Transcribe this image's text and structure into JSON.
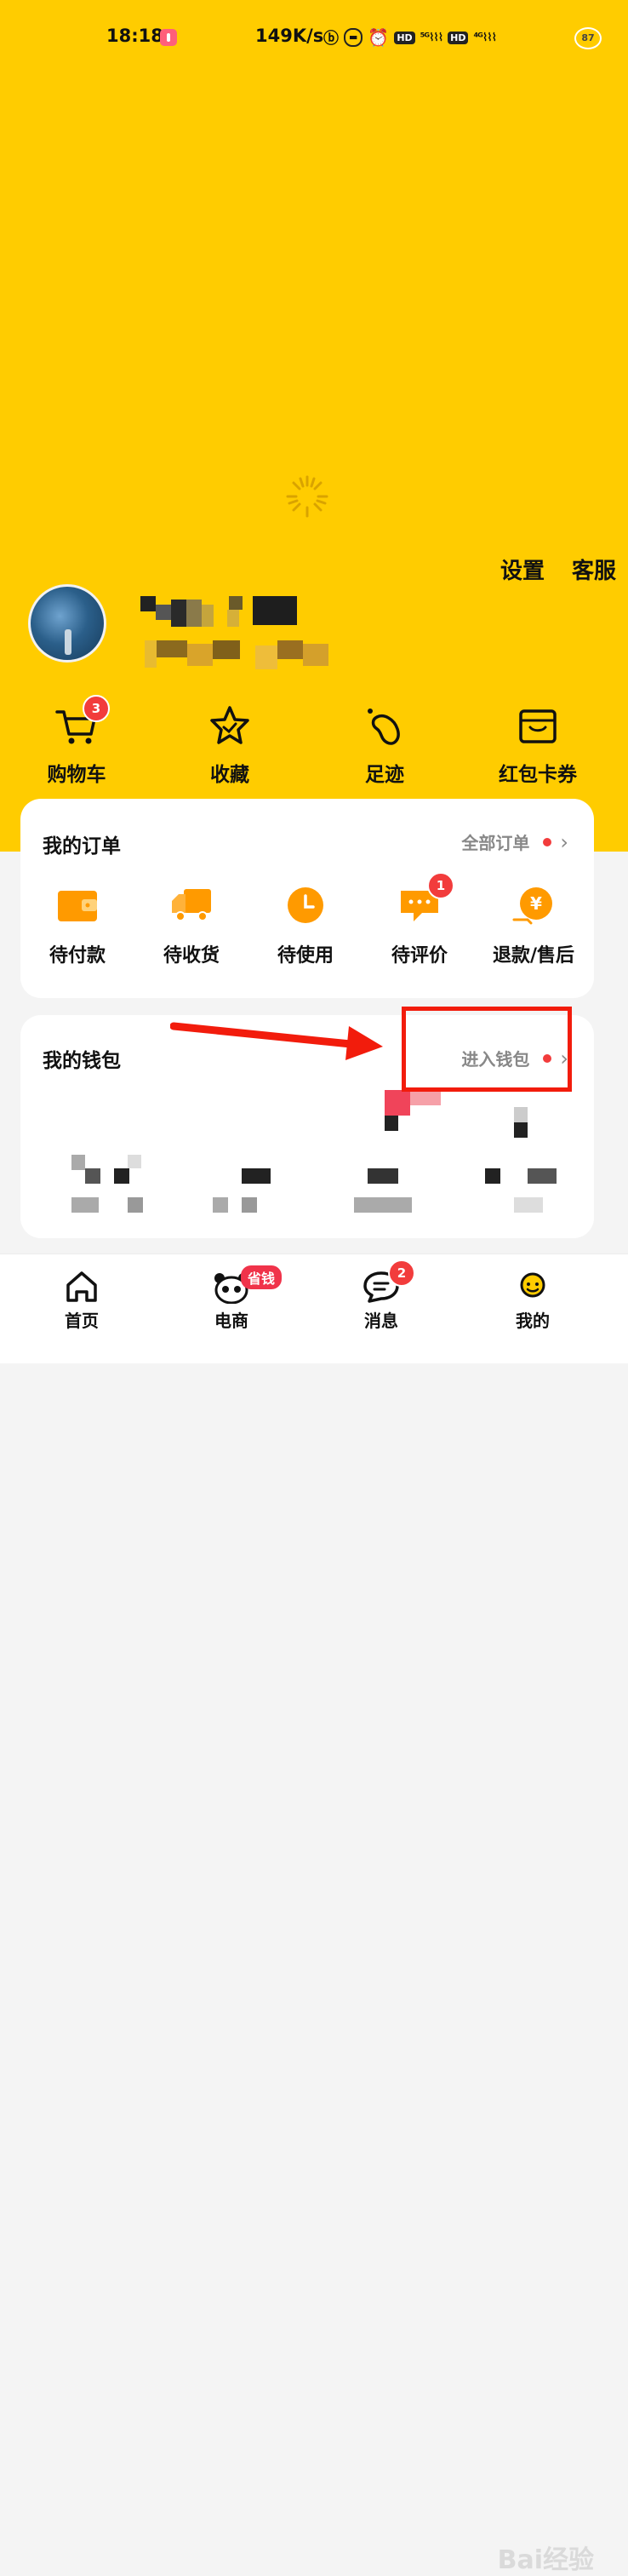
{
  "status_bar": {
    "time": "18:18",
    "net_speed": "149K/s",
    "battery": "87"
  },
  "top_actions": {
    "settings": "设置",
    "service": "客服"
  },
  "quick_links": [
    {
      "label": "购物车",
      "icon": "cart-icon",
      "badge": "3"
    },
    {
      "label": "收藏",
      "icon": "star-icon"
    },
    {
      "label": "足迹",
      "icon": "footprint-icon"
    },
    {
      "label": "红包卡券",
      "icon": "wallet-card-icon"
    }
  ],
  "orders": {
    "title": "我的订单",
    "all_link": "全部订单",
    "items": [
      {
        "label": "待付款",
        "icon": "wallet-orange-icon"
      },
      {
        "label": "待收货",
        "icon": "truck-icon"
      },
      {
        "label": "待使用",
        "icon": "clock-icon"
      },
      {
        "label": "待评价",
        "icon": "comment-icon",
        "badge": "1"
      },
      {
        "label": "退款/售后",
        "icon": "refund-icon"
      }
    ]
  },
  "wallet": {
    "title": "我的钱包",
    "enter_link": "进入钱包"
  },
  "tabbar": [
    {
      "label": "首页",
      "icon": "home-icon"
    },
    {
      "label": "电商",
      "icon": "panda-icon",
      "badge_text": "省钱"
    },
    {
      "label": "消息",
      "icon": "message-icon",
      "badge": "2"
    },
    {
      "label": "我的",
      "icon": "profile-icon"
    }
  ],
  "colors": {
    "brand_yellow": "#FFCC00",
    "badge_red": "#F23C3C",
    "icon_orange": "#FF9A00",
    "annotation_red": "#F21C0C"
  },
  "watermark": "Bai经验"
}
